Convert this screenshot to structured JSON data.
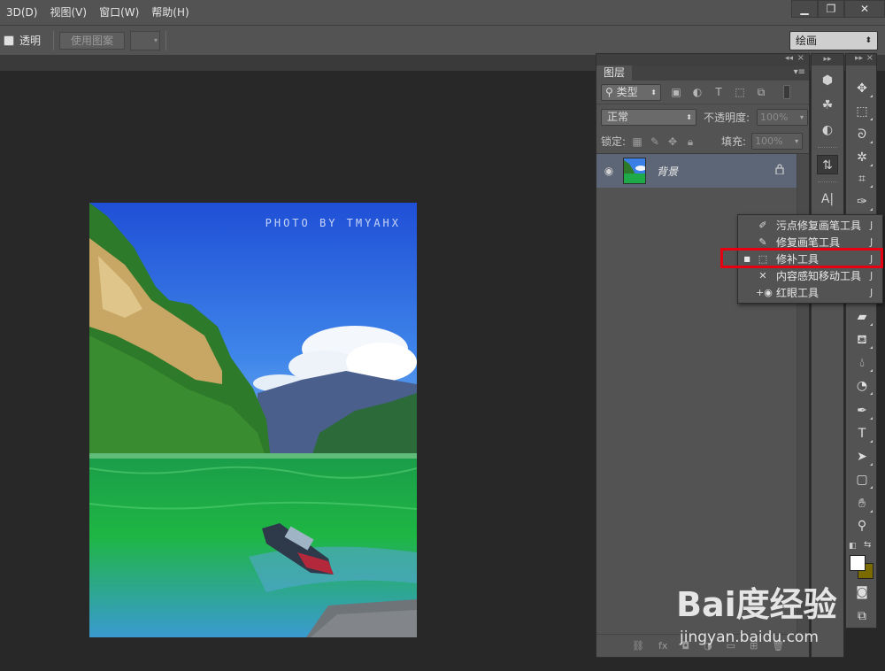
{
  "menubar": {
    "items": [
      "3D(D)",
      "视图(V)",
      "窗口(W)",
      "帮助(H)"
    ],
    "minimize": "▁",
    "restore": "❐",
    "close": "✕"
  },
  "options": {
    "transparent_label": "透明",
    "use_pattern_label": "使用图案",
    "preset": "绘画"
  },
  "canvas": {
    "watermark": "PHOTO BY TMYAHX"
  },
  "layers_panel": {
    "tab": "图层",
    "filter_type": "类型",
    "blend_mode": "正常",
    "opacity_label": "不透明度:",
    "opacity_value": "100%",
    "lock_label": "锁定:",
    "fill_label": "填充:",
    "fill_value": "100%",
    "layers": [
      {
        "name": "背景",
        "visible": true,
        "locked": true
      }
    ]
  },
  "tool_flyout": {
    "items": [
      {
        "label": "污点修复画笔工具",
        "key": "J",
        "selected": false,
        "icon": "spot-healing-brush-icon"
      },
      {
        "label": "修复画笔工具",
        "key": "J",
        "selected": false,
        "icon": "healing-brush-icon"
      },
      {
        "label": "修补工具",
        "key": "J",
        "selected": true,
        "icon": "patch-icon"
      },
      {
        "label": "内容感知移动工具",
        "key": "J",
        "selected": false,
        "icon": "content-aware-move-icon"
      },
      {
        "label": "红眼工具",
        "key": "J",
        "selected": false,
        "icon": "red-eye-icon"
      }
    ],
    "highlight_color": "#e60012"
  },
  "colors": {
    "foreground": "#ffffff",
    "background": "#7a6a00"
  },
  "watermark": {
    "brand": "Bai度经验",
    "url": "jingyan.baidu.com"
  }
}
